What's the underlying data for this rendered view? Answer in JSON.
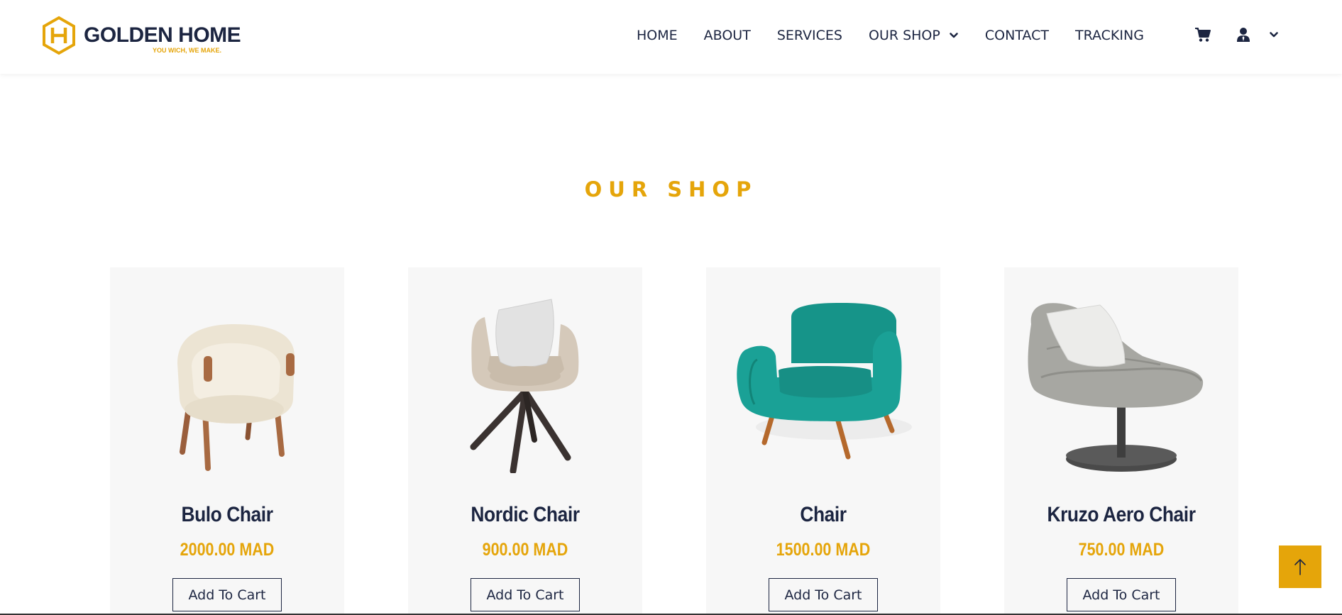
{
  "brand": {
    "name": "GOLDEN HOME",
    "tagline": "YOU WICH, WE MAKE."
  },
  "nav": {
    "items": [
      {
        "label": "HOME"
      },
      {
        "label": "ABOUT"
      },
      {
        "label": "SERVICES"
      },
      {
        "label": "OUR SHOP"
      },
      {
        "label": "CONTACT"
      },
      {
        "label": "TRACKING"
      }
    ],
    "icons": [
      "cart-icon",
      "user-icon",
      "chevron-down-icon"
    ]
  },
  "section": {
    "title": "OUR SHOP"
  },
  "products": [
    {
      "name": "Bulo Chair",
      "price": "2000.00 MAD",
      "button": "Add To Cart"
    },
    {
      "name": "Nordic Chair",
      "price": "900.00 MAD",
      "button": "Add To Cart"
    },
    {
      "name": "Chair",
      "price": "1500.00 MAD",
      "button": "Add To Cart"
    },
    {
      "name": "Kruzo Aero Chair",
      "price": "750.00 MAD",
      "button": "Add To Cart"
    }
  ],
  "colors": {
    "accent": "#e5a50a",
    "navy": "#1c2541",
    "card_bg": "#f7f7f7"
  }
}
